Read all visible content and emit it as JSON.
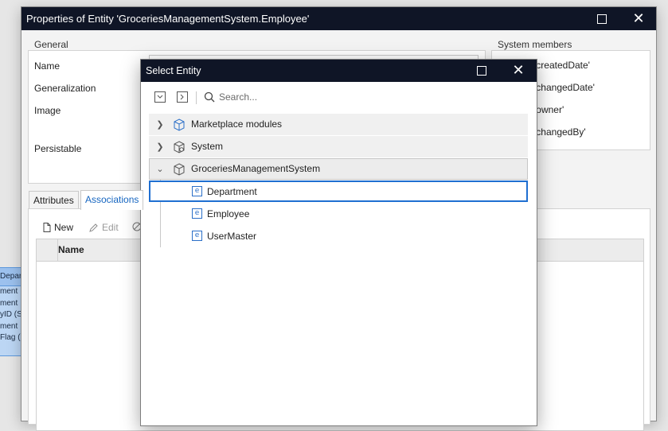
{
  "background_canvas": {
    "entity_header": "Departm",
    "entity_lines": [
      "ment",
      "ment",
      "yID (S",
      "ment",
      "Flag ("
    ]
  },
  "properties_window": {
    "title": "Properties of Entity 'GroceriesManagementSystem.Employee'",
    "general": {
      "label": "General",
      "fields": [
        "Name",
        "Generalization",
        "Image",
        "Persistable"
      ]
    },
    "system_members": {
      "label": "System members",
      "items": [
        "'createdDate'",
        "'changedDate'",
        "'owner'",
        "'changedBy'"
      ]
    },
    "tabs": [
      "Attributes",
      "Associations"
    ],
    "active_tab": "Associations",
    "toolbar": {
      "new_label": "New",
      "edit_label": "Edit"
    },
    "grid": {
      "columns": [
        "Name"
      ]
    }
  },
  "select_entity_dialog": {
    "title": "Select Entity",
    "search": {
      "placeholder": "Search...",
      "value": ""
    },
    "tree": [
      {
        "label": "Marketplace modules",
        "level": 0,
        "expanded": false,
        "icon": "marketplace-module-icon"
      },
      {
        "label": "System",
        "level": 0,
        "expanded": false,
        "icon": "system-module-icon"
      },
      {
        "label": "GroceriesManagementSystem",
        "level": 0,
        "expanded": true,
        "icon": "module-icon"
      },
      {
        "label": "Department",
        "level": 1,
        "selected": true,
        "icon": "entity-icon"
      },
      {
        "label": "Employee",
        "level": 1,
        "icon": "entity-icon"
      },
      {
        "label": "UserMaster",
        "level": 1,
        "icon": "entity-icon"
      }
    ]
  },
  "colors": {
    "titlebar": "#0f1526",
    "accent": "#1f6fd1",
    "module_icon": "#2b6fc8"
  }
}
